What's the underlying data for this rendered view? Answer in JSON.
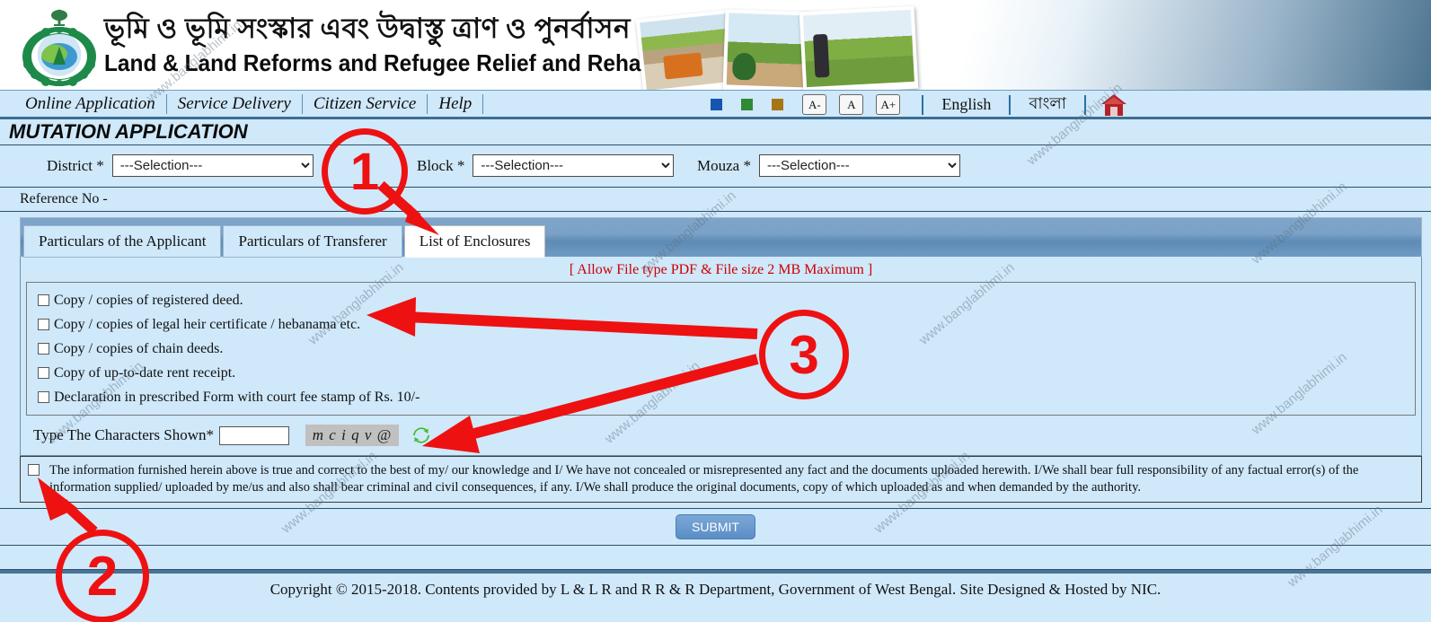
{
  "header": {
    "title_bn": "ভূমি ও ভূমি সংস্কার এবং উদ্বাস্তু ত্রাণ ও পুনর্বাসন দপ্তর",
    "title_en": "Land & Land Reforms and Refugee Relief and Rehabilitation Department",
    "emblem_name": "west-bengal-government-seal",
    "photos": [
      "farmer-tractor-photo",
      "village-road-photo",
      "field-survey-photo"
    ]
  },
  "nav": {
    "items": [
      {
        "label": "Online Application"
      },
      {
        "label": "Service Delivery"
      },
      {
        "label": "Citizen Service"
      },
      {
        "label": "Help"
      }
    ],
    "theme_swatches": [
      {
        "name": "theme-blue",
        "color": "#1557b0"
      },
      {
        "name": "theme-green",
        "color": "#2f8a36"
      },
      {
        "name": "theme-brown",
        "color": "#a87516"
      }
    ],
    "font_sizes": [
      {
        "label": "A-",
        "name": "font-decrease"
      },
      {
        "label": "A",
        "name": "font-normal"
      },
      {
        "label": "A+",
        "name": "font-increase"
      }
    ],
    "languages": [
      {
        "label": "English"
      },
      {
        "label": "বাংলা"
      }
    ],
    "home_icon": "home-icon"
  },
  "page": {
    "title": "MUTATION APPLICATION",
    "reference_label": "Reference No -"
  },
  "selection": {
    "district": {
      "label": "District *",
      "value": "---Selection---"
    },
    "block": {
      "label": "Block *",
      "value": "---Selection---"
    },
    "mouza": {
      "label": "Mouza *",
      "value": "---Selection---"
    },
    "placeholder_option": "---Selection---"
  },
  "tabs": [
    {
      "label": "Particulars of the Applicant",
      "active": false
    },
    {
      "label": "Particulars of Transferer",
      "active": false
    },
    {
      "label": "List of Enclosures",
      "active": true
    }
  ],
  "enclosures": {
    "notice": "[ Allow File type PDF & File size 2 MB Maximum ]",
    "notice_color": "#cc0000",
    "items": [
      {
        "label": "Copy / copies of registered deed.",
        "checked": false
      },
      {
        "label": "Copy / copies of legal heir certificate / hebanama etc.",
        "checked": false
      },
      {
        "label": "Copy / copies of chain deeds.",
        "checked": false
      },
      {
        "label": "Copy of up-to-date rent receipt.",
        "checked": false
      },
      {
        "label": "Declaration in prescribed Form with court fee stamp of Rs. 10/-",
        "checked": false
      }
    ]
  },
  "captcha": {
    "label": "Type The Characters Shown*",
    "input_value": "",
    "code": "m c i q v @",
    "refresh_icon": "refresh-icon"
  },
  "declaration": {
    "checked": false,
    "text": "The information furnished herein above is true and correct to the best of my/ our knowledge and I/ We have not concealed or misrepresented any fact and the documents uploaded herewith. I/We shall bear full responsibility of any factual error(s) of the information supplied/ uploaded by me/us and also shall bear criminal and civil consequences, if any. I/We shall produce the original documents, copy of which uploaded as and when demanded by the authority."
  },
  "submit": {
    "label": "SUBMIT"
  },
  "footer": {
    "text": "Copyright © 2015-2018. Contents provided by L & L R and R R & R Department, Government of West Bengal. Site Designed & Hosted by NIC."
  },
  "annotations": [
    {
      "number": "1",
      "target": "tab-list-of-enclosures"
    },
    {
      "number": "2",
      "target": "declaration-checkbox"
    },
    {
      "number": "3",
      "target": "enclosure-checkbox-list-and-captcha"
    }
  ],
  "watermark": {
    "text": "www.banglabhimi.in"
  }
}
